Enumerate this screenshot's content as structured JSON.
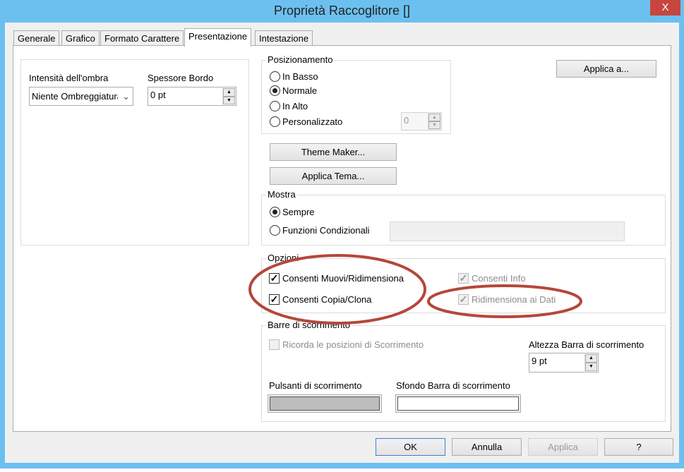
{
  "window": {
    "title": "Proprietà Raccoglitore []",
    "close_label": "X"
  },
  "tabs": [
    {
      "label": "Generale"
    },
    {
      "label": "Grafico"
    },
    {
      "label": "Formato Carattere"
    },
    {
      "label": "Presentazione",
      "active": true
    },
    {
      "label": "Intestazione"
    }
  ],
  "shadow": {
    "label": "Intensità dell'ombra",
    "value": "Niente Ombreggiatura"
  },
  "border": {
    "label": "Spessore Bordo",
    "value": "0 pt"
  },
  "positioning": {
    "label": "Posizionamento",
    "options": [
      "In Basso",
      "Normale",
      "In Alto",
      "Personalizzato"
    ],
    "selected": "Normale",
    "custom_value": "0"
  },
  "apply_to_label": "Applica a...",
  "theme_maker_label": "Theme Maker...",
  "apply_theme_label": "Applica Tema...",
  "show": {
    "label": "Mostra",
    "options": [
      "Sempre",
      "Funzioni Condizionali"
    ],
    "selected": "Sempre"
  },
  "options": {
    "label": "Opzioni",
    "items": [
      {
        "label": "Consenti Muovi/Ridimensiona",
        "checked": true,
        "enabled": true
      },
      {
        "label": "Consenti Copia/Clona",
        "checked": true,
        "enabled": true
      },
      {
        "label": "Consenti Info",
        "checked": true,
        "enabled": false
      },
      {
        "label": "Ridimensiona ai Dati",
        "checked": true,
        "enabled": false
      }
    ]
  },
  "scrollbars": {
    "label": "Barre di scorrimento",
    "remember_label": "Ricorda le posizioni di Scorrimento",
    "height_label": "Altezza Barra di scorrimento",
    "height_value": "9 pt",
    "buttons_label": "Pulsanti di scorrimento",
    "buttons_color": "#bcbcbc",
    "background_label": "Sfondo Barra di scorrimento",
    "background_color": "#ffffff"
  },
  "footer": {
    "ok": "OK",
    "cancel": "Annulla",
    "apply": "Applica",
    "help": "?"
  },
  "annotation_color": "#b5473a"
}
